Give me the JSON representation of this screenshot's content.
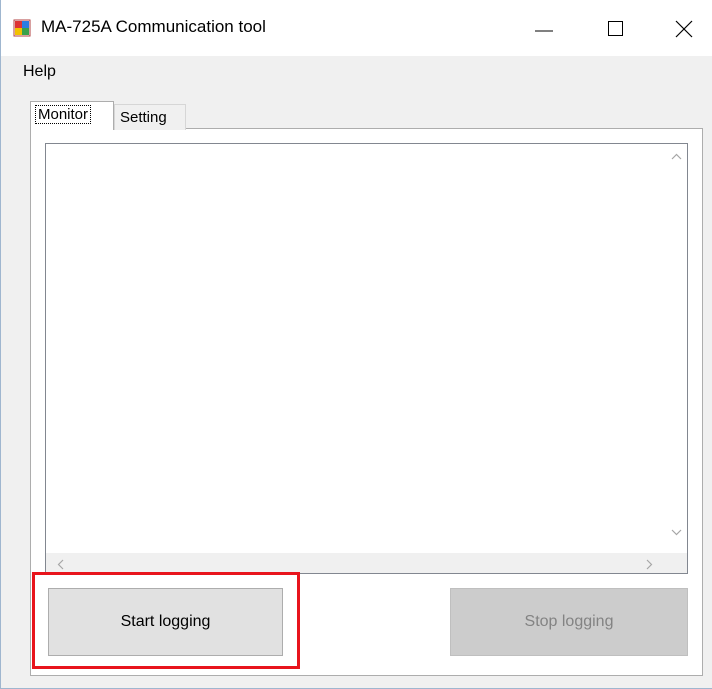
{
  "window": {
    "title": "MA-725A Communication tool",
    "controls": {
      "minimize": "minimize-icon",
      "maximize": "maximize-icon",
      "close": "close-icon"
    }
  },
  "menu": {
    "items": [
      "Help"
    ]
  },
  "tabs": [
    {
      "label": "Monitor",
      "selected": true
    },
    {
      "label": "Setting",
      "selected": false
    }
  ],
  "monitor": {
    "log_text": "",
    "start_button": "Start logging",
    "stop_button": "Stop logging",
    "stop_enabled": false
  },
  "colors": {
    "highlight": "#e8141c",
    "disabled_text": "#838383"
  }
}
